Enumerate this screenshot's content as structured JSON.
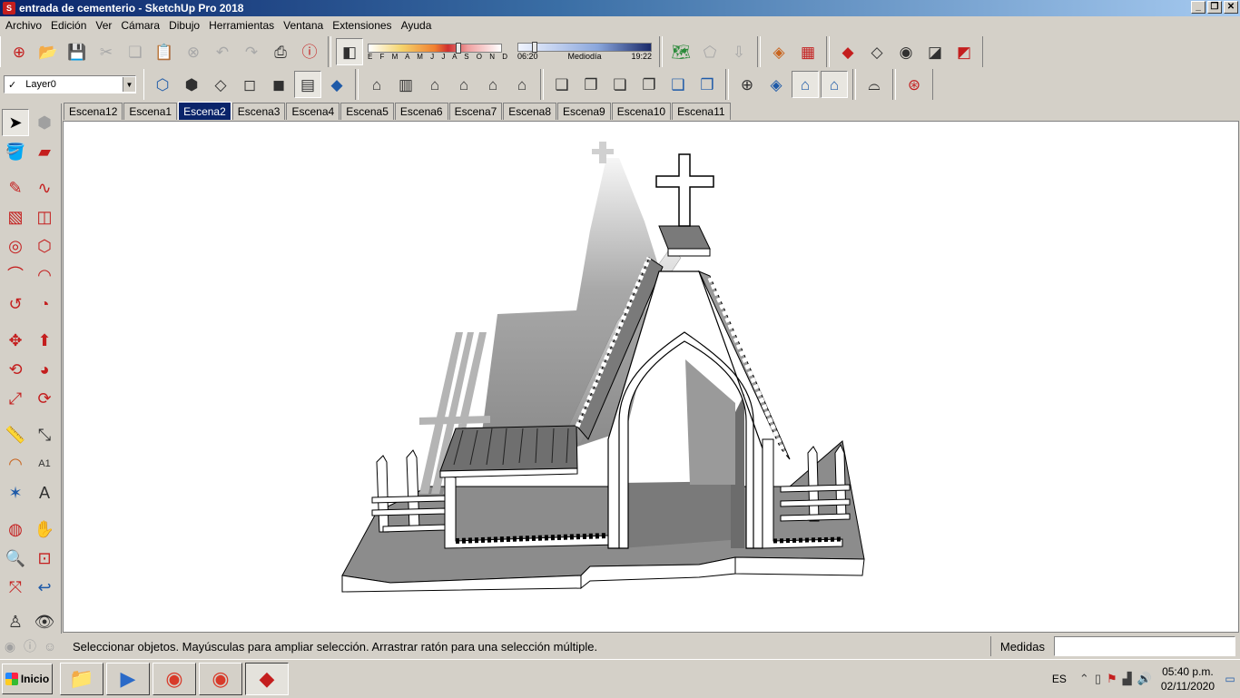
{
  "window": {
    "title": "entrada de cementerio - SketchUp Pro 2018",
    "minimize": "_",
    "restore": "❐",
    "close": "✕"
  },
  "menu": [
    "Archivo",
    "Edición",
    "Ver",
    "Cámara",
    "Dibujo",
    "Herramientas",
    "Ventana",
    "Extensiones",
    "Ayuda"
  ],
  "shadows": {
    "months": "E F M A M J J A S O N D",
    "time_start": "06:20",
    "time_mid": "Mediodía",
    "time_end": "19:22",
    "month_position": 0.66,
    "time_position": 0.1
  },
  "layer": {
    "check": "✓",
    "current": "Layer0"
  },
  "scenes": [
    "Escena12",
    "Escena1",
    "Escena2",
    "Escena3",
    "Escena4",
    "Escena5",
    "Escena6",
    "Escena7",
    "Escena8",
    "Escena9",
    "Escena10",
    "Escena11"
  ],
  "active_scene": "Escena2",
  "model": {
    "name": "cemetery-entrance-3d-model",
    "colors": {
      "face_gray": "#8a8a8a",
      "face_dark": "#6a6a6a",
      "edge": "#000000",
      "white": "#ffffff"
    }
  },
  "status": {
    "message": "Seleccionar objetos. Mayúsculas para ampliar selección. Arrastrar ratón para una selección múltiple.",
    "measures_label": "Medidas",
    "measures_value": ""
  },
  "taskbar": {
    "start_label": "Inicio",
    "language": "ES",
    "time": "05:40 p.m.",
    "date": "02/11/2020"
  }
}
